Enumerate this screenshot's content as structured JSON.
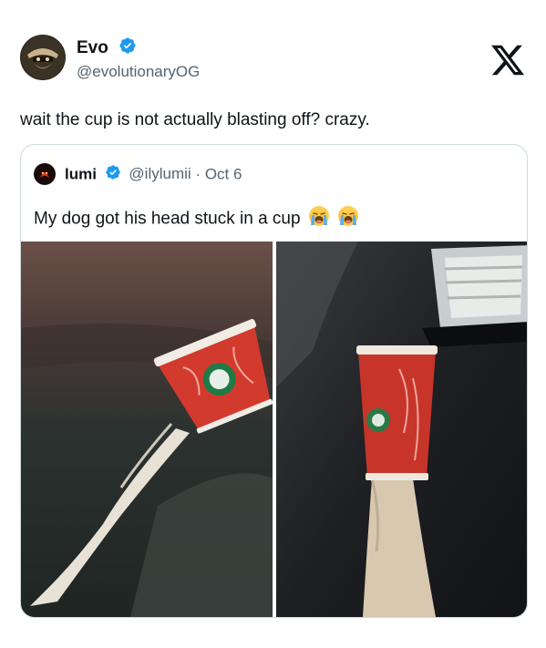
{
  "tweet": {
    "display_name": "Evo",
    "handle": "@evolutionaryOG",
    "text": "wait the cup is not actually blasting off? crazy.",
    "verified": true
  },
  "quoted_tweet": {
    "display_name": "lumi",
    "handle": "@ilylumii",
    "separator": "·",
    "date": "Oct 6",
    "text": "My dog got his head stuck in a cup",
    "emoji": [
      "loudly-crying-face",
      "loudly-crying-face"
    ],
    "verified": true
  },
  "colors": {
    "verified_badge": "#1d9bf0",
    "secondary_text": "#536471",
    "border": "#cfd9de"
  },
  "icons": {
    "platform_logo": "x-logo",
    "verified": "verified-badge-icon"
  }
}
